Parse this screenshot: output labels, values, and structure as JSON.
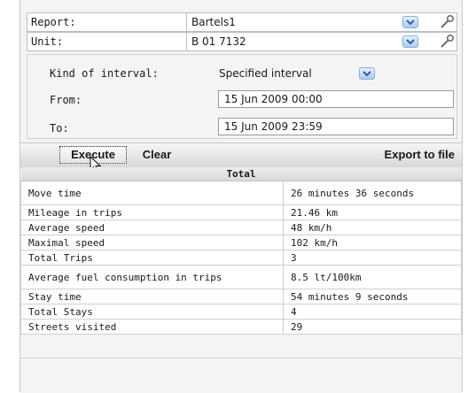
{
  "report": {
    "label": "Report:",
    "value": "Bartels1"
  },
  "unit": {
    "label": "Unit:",
    "value": "B 01 7132"
  },
  "interval": {
    "kind_label": "Kind of interval:",
    "kind_value": "Specified interval",
    "from_label": "From:",
    "from_value": "15 Jun 2009 00:00",
    "to_label": "To:",
    "to_value": "15 Jun 2009 23:59"
  },
  "buttons": {
    "execute": "Execute",
    "clear": "Clear",
    "export": "Export to file"
  },
  "results": {
    "header": "Total",
    "rows": [
      {
        "label": "Move time",
        "value": "26 minutes 36 seconds"
      },
      {
        "label": "Mileage in trips",
        "value": "21.46 km"
      },
      {
        "label": "Average speed",
        "value": "48 km/h"
      },
      {
        "label": "Maximal speed",
        "value": "102 km/h"
      },
      {
        "label": "Total Trips",
        "value": "3"
      },
      {
        "label": "Average fuel consumption in trips",
        "value": "8.5 lt/100km"
      },
      {
        "label": "Stay time",
        "value": "54 minutes 9 seconds"
      },
      {
        "label": "Total Stays",
        "value": "4"
      },
      {
        "label": "Streets visited",
        "value": "29"
      }
    ]
  },
  "icons": {
    "dropdown": "chevron-down-icon",
    "settings": "wrench-icon",
    "cursor": "mouse-pointer-icon"
  }
}
